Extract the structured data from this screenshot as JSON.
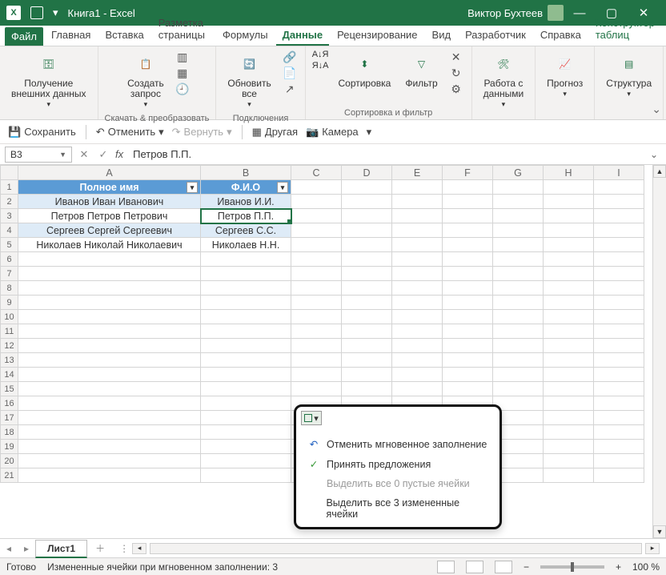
{
  "title": "Книга1 - Excel",
  "user_name": "Виктор Бухтеев",
  "tabs": {
    "file": "Файл",
    "items": [
      "Главная",
      "Вставка",
      "Разметка страницы",
      "Формулы",
      "Данные",
      "Рецензирование",
      "Вид",
      "Разработчик",
      "Справка",
      "Конструктор таблиц"
    ],
    "active_index": 4
  },
  "ribbon": {
    "groups": [
      {
        "big": "Получение\nвнешних данных"
      },
      {
        "big": "Создать\nзапрос",
        "label": "Скачать & преобразовать"
      },
      {
        "big": "Обновить\nвсе",
        "label": "Подключения"
      },
      {
        "sort_asc": "А↓Я",
        "sort_desc": "Я↓А",
        "sort_btn": "Сортировка",
        "filter_btn": "Фильтр",
        "label": "Сортировка и фильтр"
      },
      {
        "big": "Работа с\nданными"
      },
      {
        "big": "Прогноз"
      },
      {
        "big": "Структура"
      }
    ]
  },
  "qat": {
    "save": "Сохранить",
    "undo": "Отменить",
    "redo": "Вернуть",
    "other": "Другая",
    "camera": "Камера"
  },
  "fxrow": {
    "namebox": "B3",
    "fx": "fx",
    "formula": "Петров П.П."
  },
  "grid": {
    "cols": [
      "A",
      "B",
      "C",
      "D",
      "E",
      "F",
      "G",
      "H",
      "I"
    ],
    "headers": {
      "A": "Полное имя",
      "B": "Ф.И.О"
    },
    "rows": [
      {
        "n": 1
      },
      {
        "n": 2,
        "A": "Иванов Иван Иванович",
        "B": "Иванов И.И.",
        "band": true
      },
      {
        "n": 3,
        "A": "Петров Петров Петрович",
        "B": "Петров П.П.",
        "selected": true
      },
      {
        "n": 4,
        "A": "Сергеев Сергей Сергеевич",
        "B": "Сергеев С.С.",
        "band": true
      },
      {
        "n": 5,
        "A": "Николаев Николай Николаевич",
        "B": "Николаев Н.Н."
      },
      {
        "n": 6
      },
      {
        "n": 7
      },
      {
        "n": 8
      },
      {
        "n": 9
      },
      {
        "n": 10
      },
      {
        "n": 11
      },
      {
        "n": 12
      },
      {
        "n": 13
      },
      {
        "n": 14
      },
      {
        "n": 15
      },
      {
        "n": 16
      },
      {
        "n": 17
      },
      {
        "n": 18
      },
      {
        "n": 19
      },
      {
        "n": 20
      },
      {
        "n": 21
      }
    ]
  },
  "smarttag": {
    "items": [
      {
        "icon": "undo",
        "label": "Отменить мгновенное заполнение"
      },
      {
        "icon": "check",
        "label": "Принять предложения"
      },
      {
        "label": "Выделить все 0 пустые ячейки",
        "disabled": true
      },
      {
        "label": "Выделить все 3 измененные ячейки"
      }
    ]
  },
  "sheettab": {
    "name": "Лист1"
  },
  "statusbar": {
    "ready": "Готово",
    "msg": "Измененные ячейки при мгновенном заполнении: 3",
    "zoom": "100 %"
  }
}
